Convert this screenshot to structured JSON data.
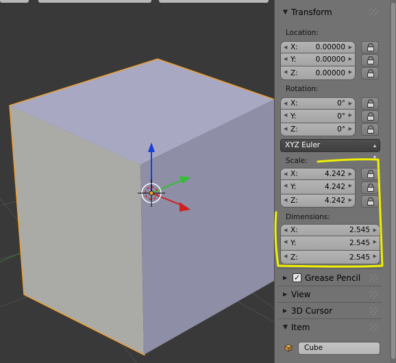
{
  "transform": {
    "title": "Transform",
    "location_label": "Location:",
    "location": [
      {
        "axis": "X:",
        "value": "0.00000"
      },
      {
        "axis": "Y:",
        "value": "0.00000"
      },
      {
        "axis": "Z:",
        "value": "0.00000"
      }
    ],
    "rotation_label": "Rotation:",
    "rotation": [
      {
        "axis": "X:",
        "value": "0°"
      },
      {
        "axis": "Y:",
        "value": "0°"
      },
      {
        "axis": "Z:",
        "value": "0°"
      }
    ],
    "rotation_mode": "XYZ Euler",
    "scale_label": "Scale:",
    "scale": [
      {
        "axis": "X:",
        "value": "4.242"
      },
      {
        "axis": "Y:",
        "value": "4.242"
      },
      {
        "axis": "Z:",
        "value": "4.242"
      }
    ],
    "dimensions_label": "Dimensions:",
    "dimensions": [
      {
        "axis": "X:",
        "value": "2.545"
      },
      {
        "axis": "Y:",
        "value": "2.545"
      },
      {
        "axis": "Z:",
        "value": "2.545"
      }
    ]
  },
  "panels": {
    "grease_pencil": "Grease Pencil",
    "view": "View",
    "cursor_3d": "3D Cursor",
    "item": "Item"
  },
  "item": {
    "name": "Cube"
  },
  "icons": {
    "expanded": "triangle-down-icon",
    "collapsed": "triangle-right-icon",
    "lock": "lock-icon",
    "object": "cube-icon"
  },
  "colors": {
    "highlight": "#f0f000",
    "selection_outline": "#f0a030",
    "axis_x": "#d02020",
    "axis_y": "#30c030",
    "axis_z": "#1a3cd8"
  }
}
